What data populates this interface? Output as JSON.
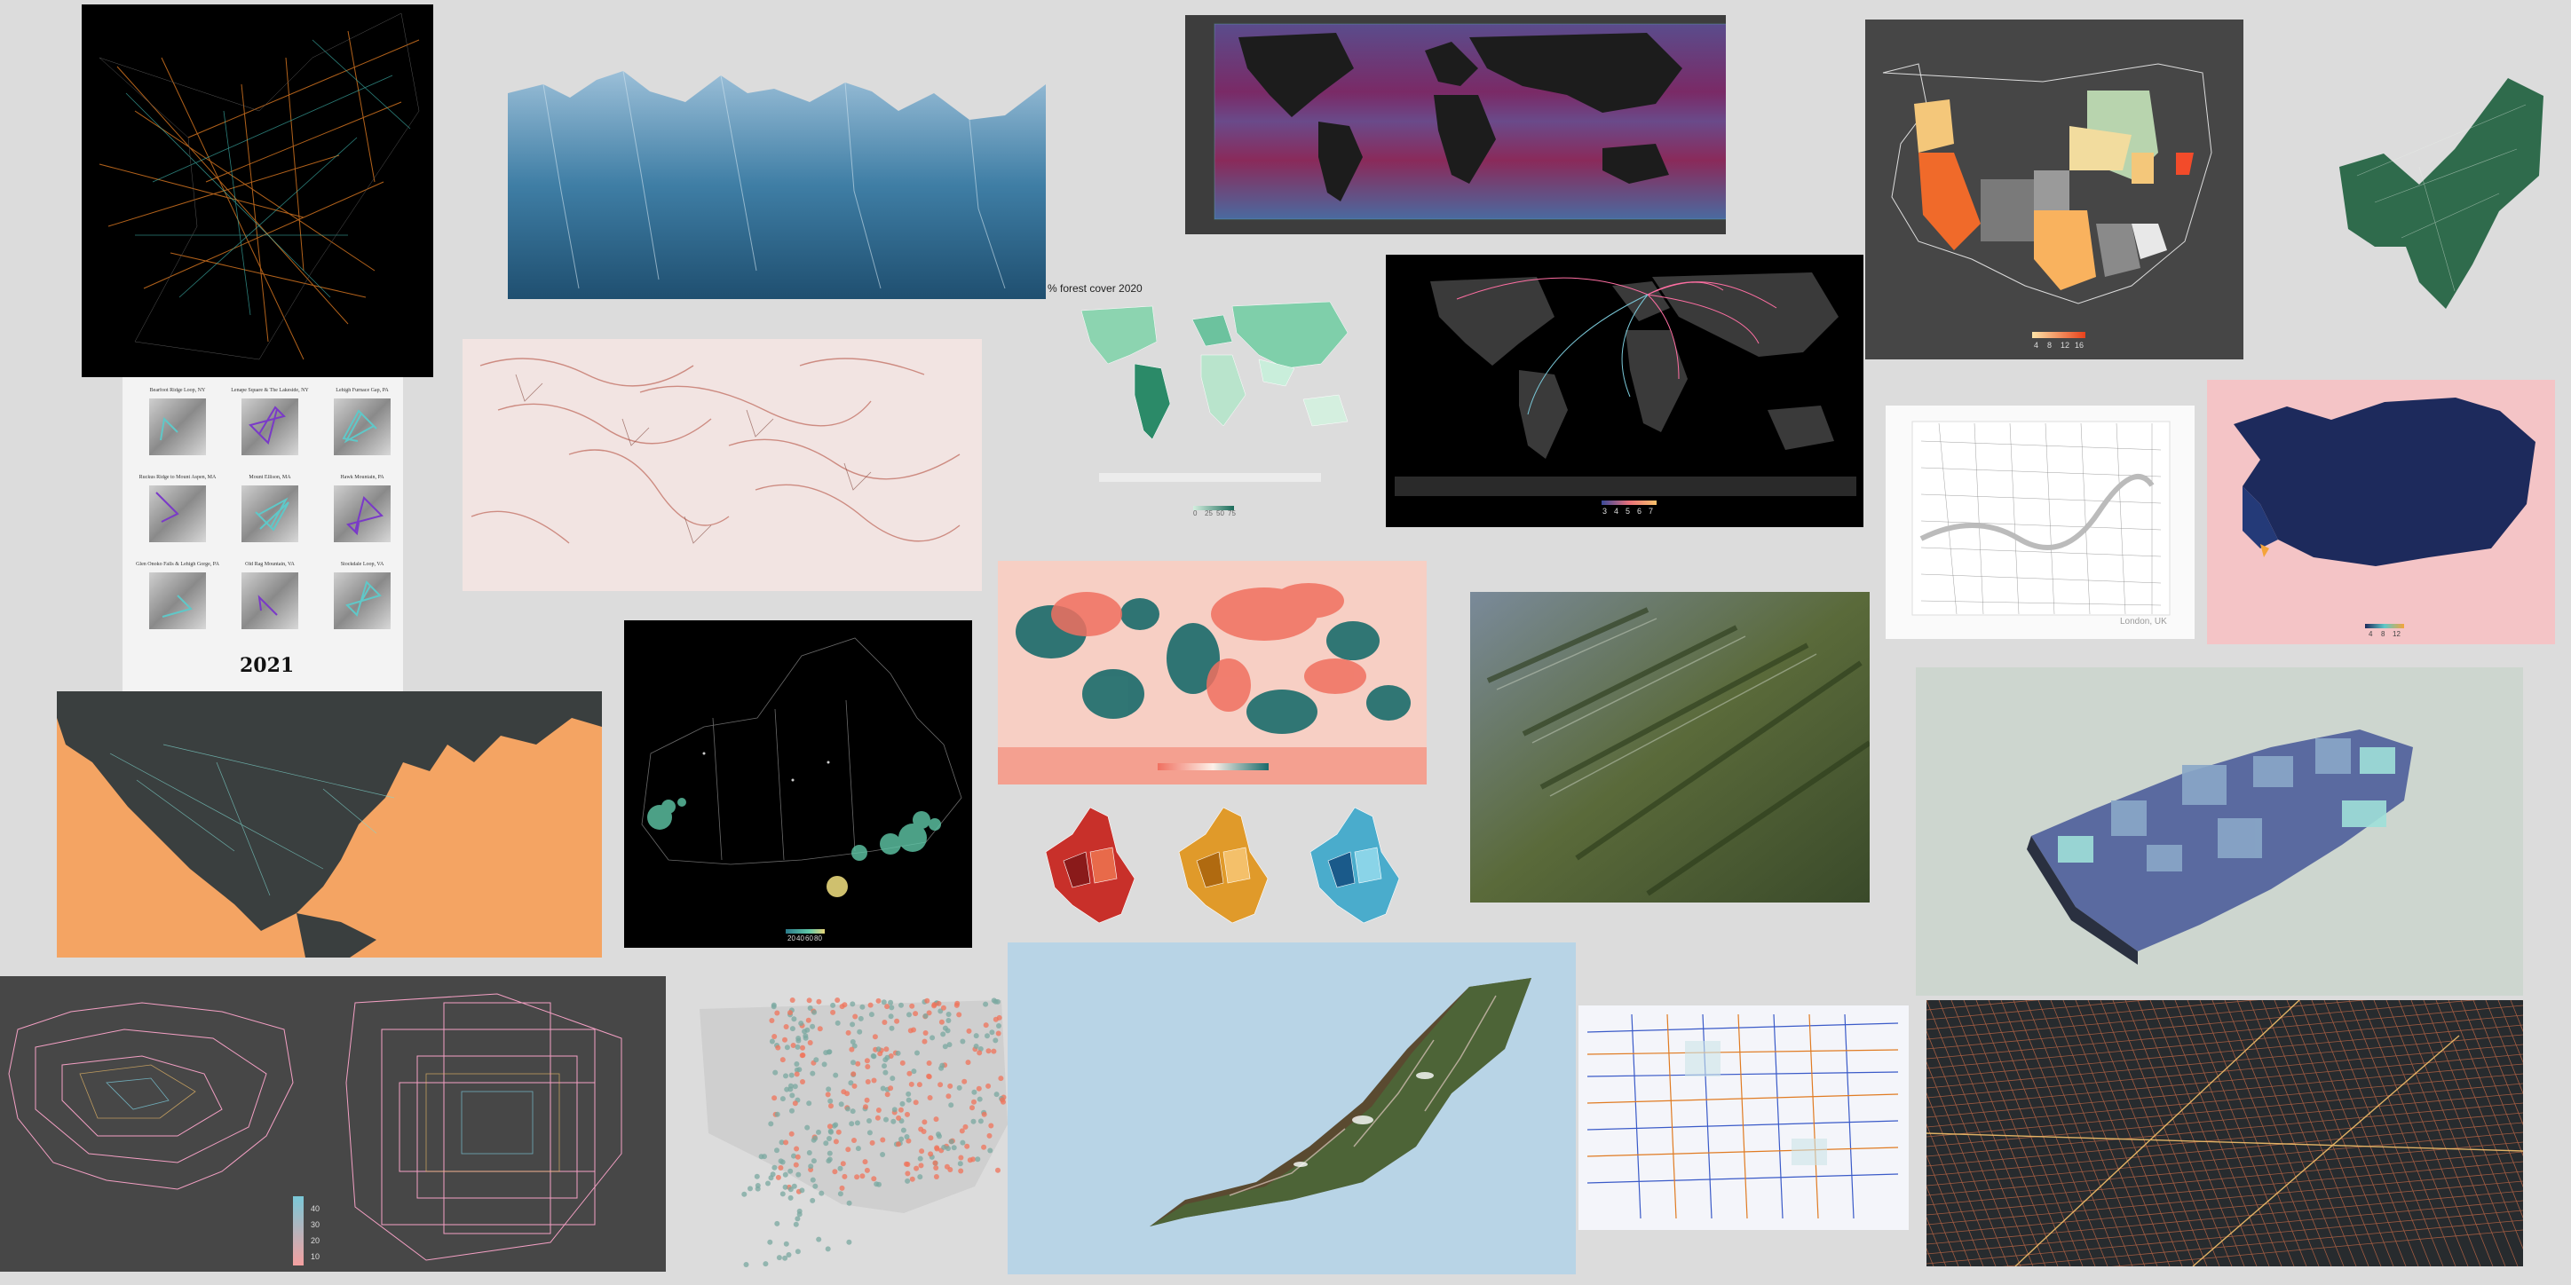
{
  "gallery": {
    "forest_title": "% forest cover 2020",
    "forest_ticks": [
      "0",
      "25",
      "50",
      "75"
    ],
    "flights_ticks": [
      "3",
      "4",
      "5",
      "6",
      "7"
    ],
    "us_ticks": [
      "4",
      "8",
      "12",
      "16"
    ],
    "iceland_ticks": [
      "4",
      "8",
      "12"
    ],
    "canada_ticks": [
      "20",
      "40",
      "60",
      "80"
    ],
    "loops_ticks": [
      "40",
      "30",
      "20",
      "10"
    ],
    "london_caption": "London, UK",
    "hikes_year": "2021",
    "hikes": [
      {
        "title": "Bearfoot Ridge Loop, NY"
      },
      {
        "title": "Lenape Square & The Lakeside, NY"
      },
      {
        "title": "Lehigh Furnace Gap, PA"
      },
      {
        "title": "Ruckus Ridge to Mount Aspen, MA"
      },
      {
        "title": "Mount Ellison, MA"
      },
      {
        "title": "Hawk Mountain, PA"
      },
      {
        "title": "Glen Onoko Falls & Lehigh Gorge, PA"
      },
      {
        "title": "Old Rag Mountain, VA"
      },
      {
        "title": "Stockdale Loop, VA"
      }
    ]
  },
  "colors": {
    "background": "#dcdcdc",
    "forest_low": "#d4efdf",
    "forest_high": "#1b6b5a",
    "flights_pink": "#ff6fa3",
    "us_orange": "#f06a2a",
    "iceland_navy": "#1d2a5c",
    "iceland_bg": "#f4c4c6",
    "northamerica_bg": "#f4a463"
  }
}
